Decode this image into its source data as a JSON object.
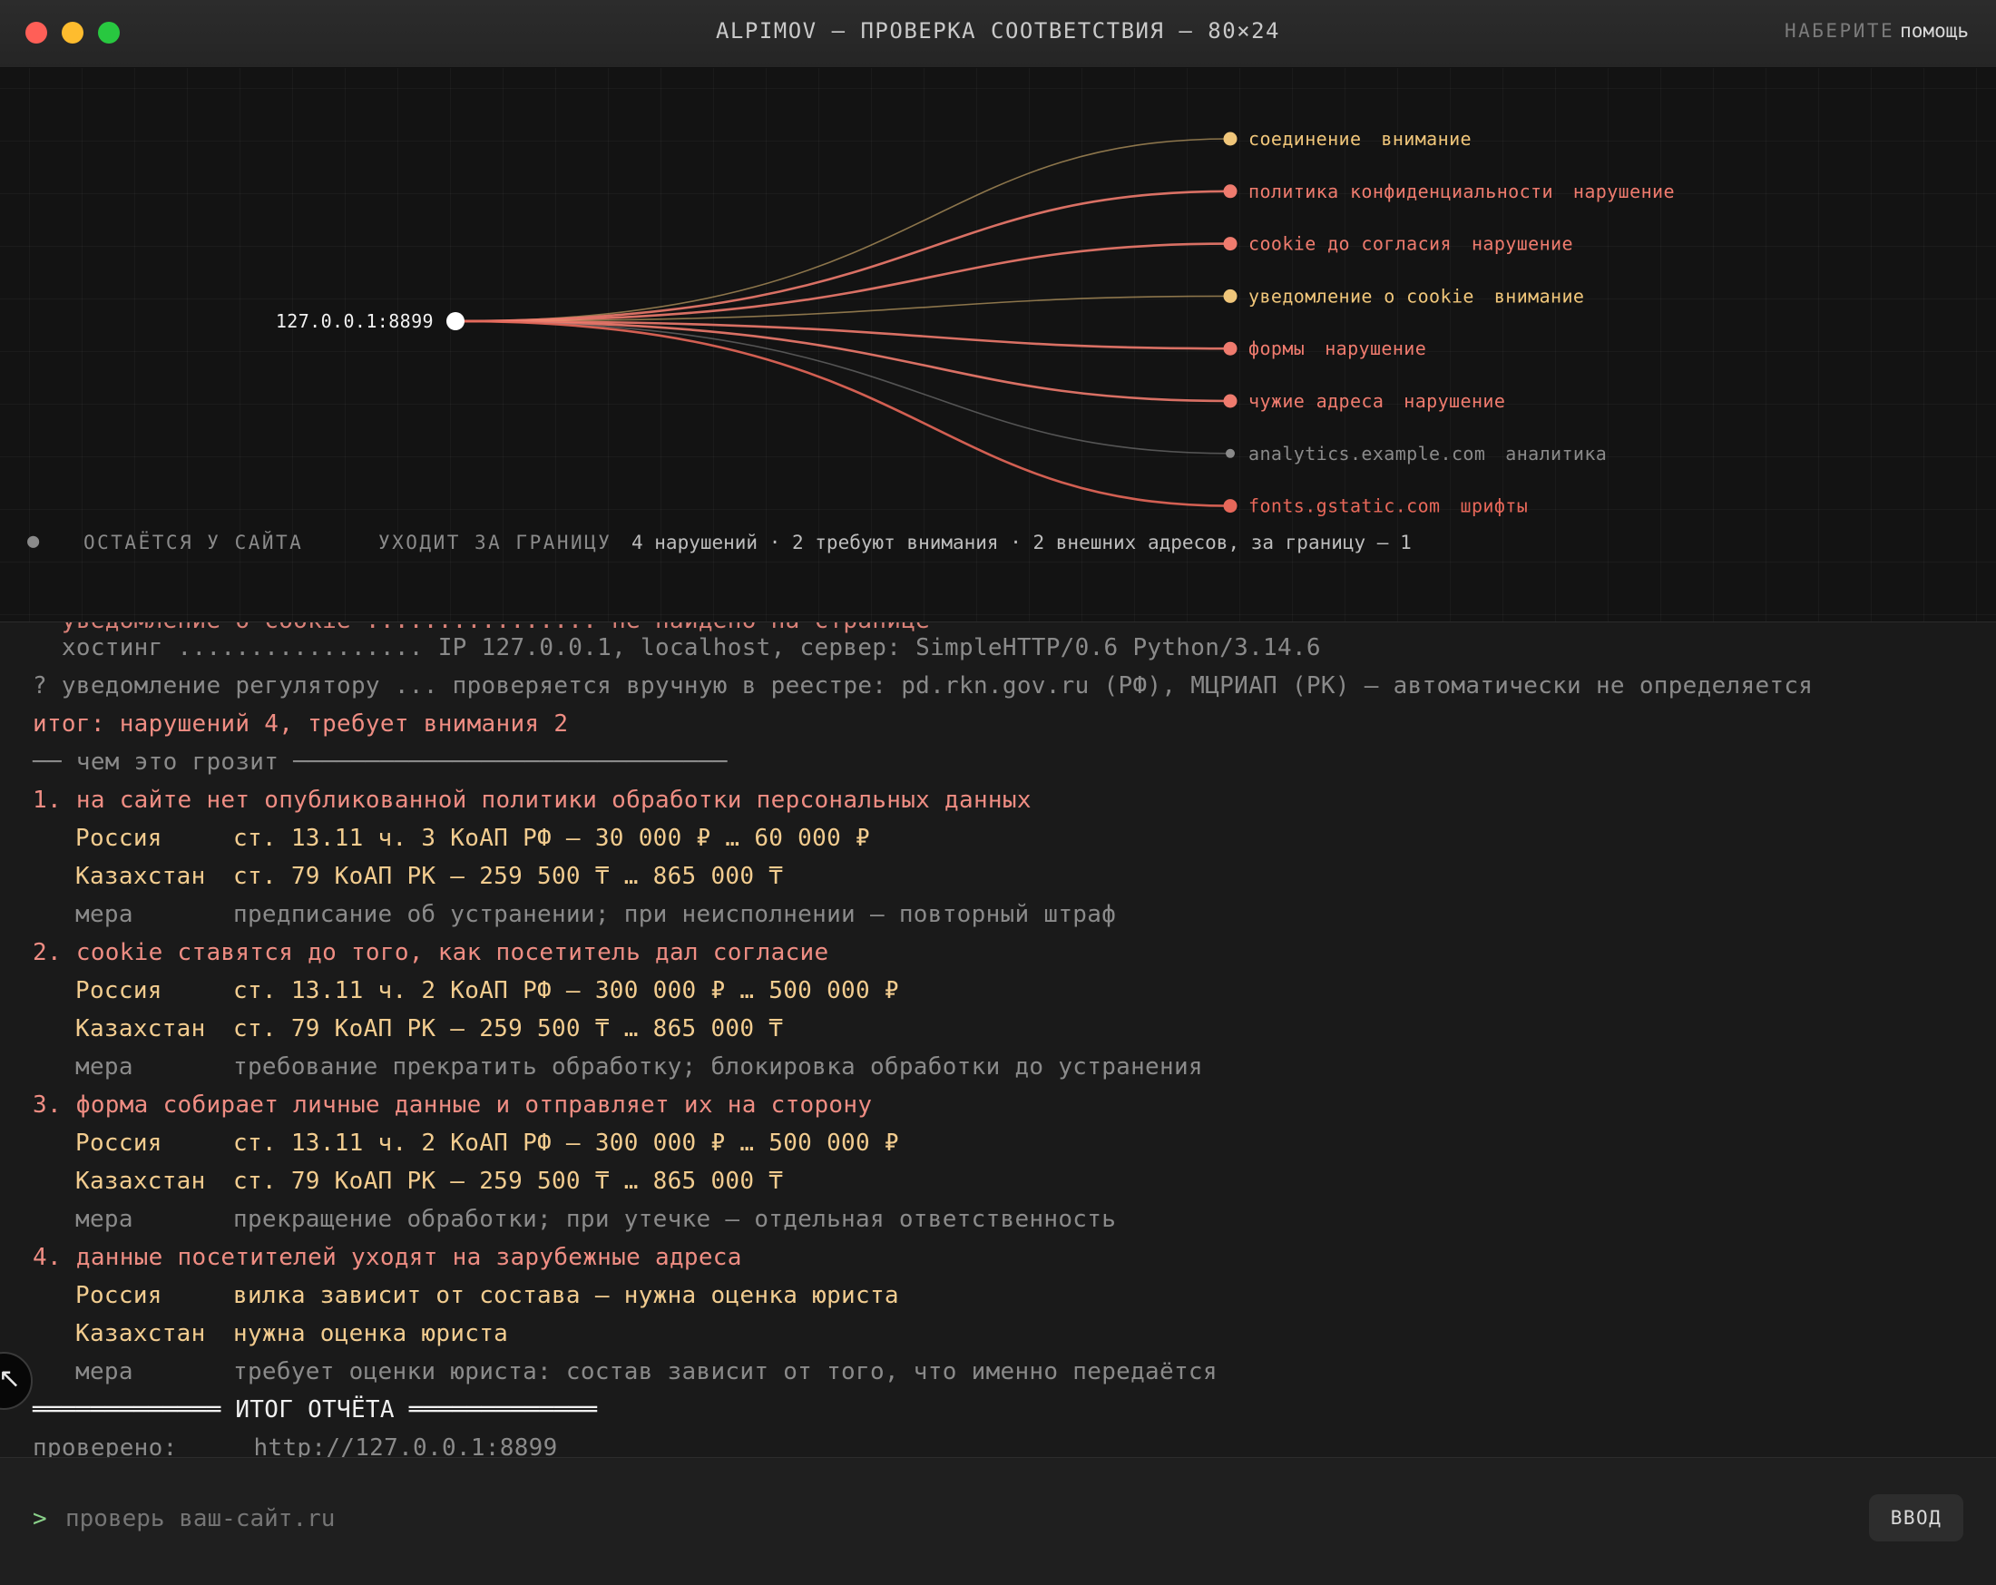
{
  "window": {
    "title": "ALPIMOV — ПРОВЕРКА СООТВЕТСТВИЯ — 80×24",
    "help_key": "НАБЕРИТЕ",
    "help_word": "помощь",
    "traffic_lights": [
      "#ff5f57",
      "#febc2e",
      "#28c840"
    ]
  },
  "graph": {
    "root": "127.0.0.1:8899",
    "colors": {
      "violation": "#ef7b6e",
      "attention": "#f0c67a",
      "analytics": "#8a8a8a",
      "fonts": "#e8685a"
    },
    "nodes": [
      {
        "name": "соединение",
        "status": "внимание",
        "kind": "attention"
      },
      {
        "name": "политика конфиденциальности",
        "status": "нарушение",
        "kind": "violation"
      },
      {
        "name": "cookie до согласия",
        "status": "нарушение",
        "kind": "violation"
      },
      {
        "name": "уведомление о cookie",
        "status": "внимание",
        "kind": "attention"
      },
      {
        "name": "формы",
        "status": "нарушение",
        "kind": "violation"
      },
      {
        "name": "чужие адреса",
        "status": "нарушение",
        "kind": "violation"
      },
      {
        "name": "analytics.example.com",
        "status": "аналитика",
        "kind": "analytics"
      },
      {
        "name": "fonts.gstatic.com",
        "status": "шрифты",
        "kind": "fonts"
      }
    ]
  },
  "legend": {
    "stays": "ОСТАЁТСЯ У САЙТА",
    "leaves": "УХОДИТ ЗА ГРАНИЦУ",
    "summary": "4 нарушений · 2 требуют внимания · 2 внешних адресов, за границу — 1"
  },
  "terminal": {
    "partial_top": "  уведомление о cookie ................ не найдено на странице",
    "hosting": "  хостинг ................. IP 127.0.0.1, localhost, сервер: SimpleHTTP/0.6 Python/3.14.6",
    "regulator": "? уведомление регулятору ... проверяется вручную в реестре: pd.rkn.gov.ru (РФ), МЦРИАП (РК) — автоматически не определяется",
    "total": "итог: нарушений 4, требует внимания 2",
    "threat_header": "── чем это грозит ──────────────────────────────",
    "issues": [
      {
        "title": "1. на сайте нет опубликованной политики обработки персональных данных",
        "ru_label": "Россия",
        "ru": "ст. 13.11 ч. 3 КоАП РФ — 30 000 ₽ … 60 000 ₽",
        "kz_label": "Казахстан",
        "kz": "ст. 79 КоАП РК — 259 500 ₸ … 865 000 ₸",
        "measure_label": "мера",
        "measure": "предписание об устранении; при неисполнении — повторный штраф"
      },
      {
        "title": "2. cookie ставятся до того, как посетитель дал согласие",
        "ru_label": "Россия",
        "ru": "ст. 13.11 ч. 2 КоАП РФ — 300 000 ₽ … 500 000 ₽",
        "kz_label": "Казахстан",
        "kz": "ст. 79 КоАП РК — 259 500 ₸ … 865 000 ₸",
        "measure_label": "мера",
        "measure": "требование прекратить обработку; блокировка обработки до устранения"
      },
      {
        "title": "3. форма собирает личные данные и отправляет их на сторону",
        "ru_label": "Россия",
        "ru": "ст. 13.11 ч. 2 КоАП РФ — 300 000 ₽ … 500 000 ₽",
        "kz_label": "Казахстан",
        "kz": "ст. 79 КоАП РК — 259 500 ₸ … 865 000 ₸",
        "measure_label": "мера",
        "measure": "прекращение обработки; при утечке — отдельная ответственность"
      },
      {
        "title": "4. данные посетителей уходят на зарубежные адреса",
        "ru_label": "Россия",
        "ru": "вилка зависит от состава — нужна оценка юриста",
        "kz_label": "Казахстан",
        "kz": "нужна оценка юриста",
        "measure_label": "мера",
        "measure": "требует оценки юриста: состав зависит от того, что именно передаётся"
      }
    ],
    "report_header": "═════════════ ИТОГ ОТЧЁТА ═════════════",
    "checked_label": "проверено:",
    "checked_value": "http://127.0.0.1:8899"
  },
  "input": {
    "prompt": ">",
    "placeholder": "проверь ваш-сайт.ru",
    "enter_label": "ВВОД"
  },
  "side_badge_icon": "arrow-icon"
}
